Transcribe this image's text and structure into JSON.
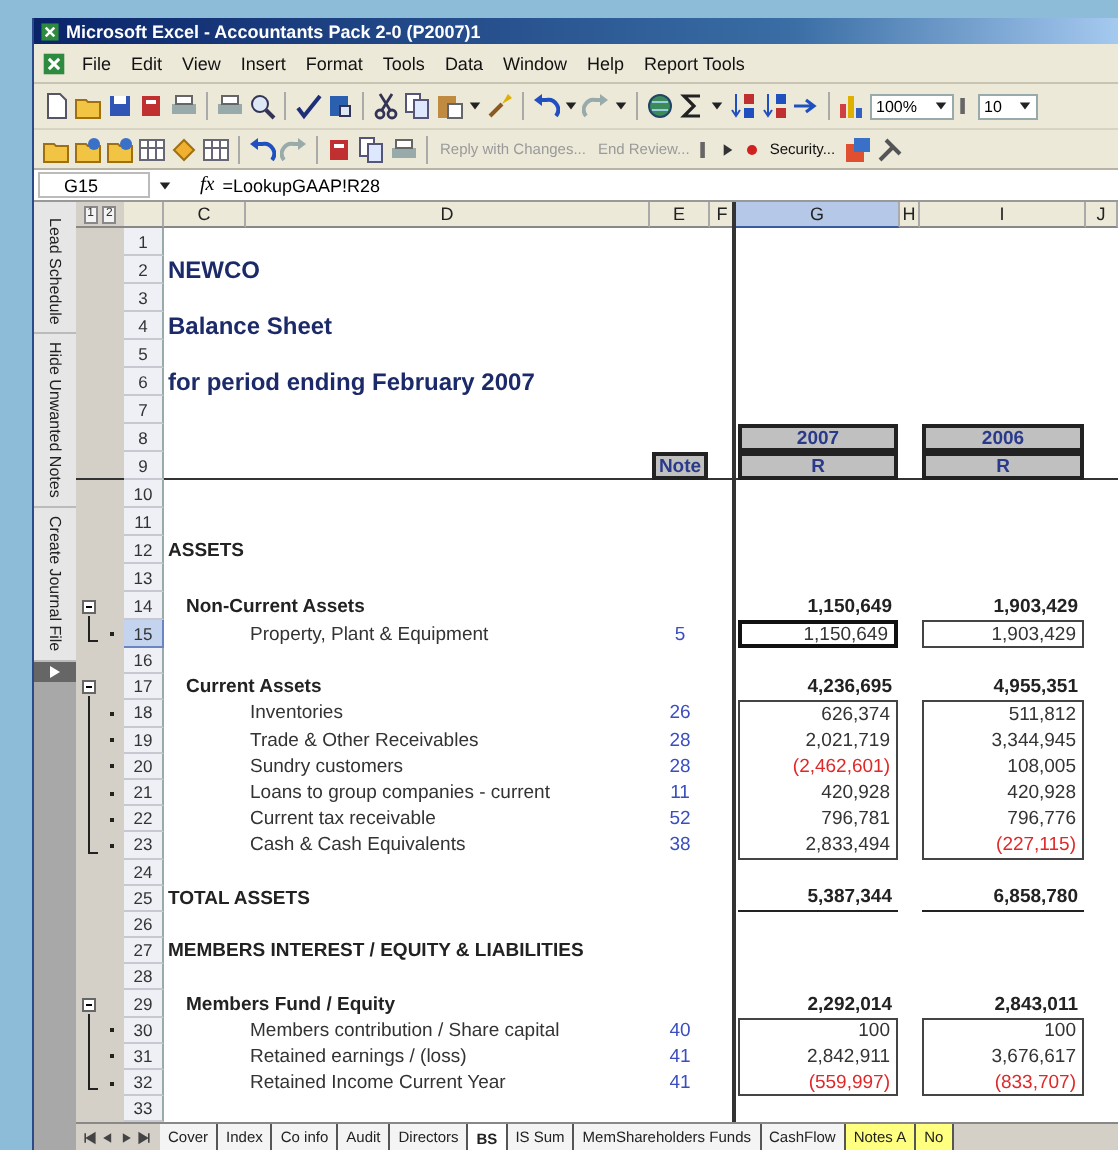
{
  "window": {
    "title": "Microsoft Excel - Accountants Pack 2-0 (P2007)1"
  },
  "menu": [
    "File",
    "Edit",
    "View",
    "Insert",
    "Format",
    "Tools",
    "Data",
    "Window",
    "Help",
    "Report Tools"
  ],
  "toolbar_1": {
    "zoom": "100%",
    "font_size": "10"
  },
  "toolbar_2": {
    "buttons": [
      {
        "label": "Reply with Changes...",
        "disabled": true
      },
      {
        "label": "End Review...",
        "disabled": true
      },
      {
        "label": "Security...",
        "disabled": false
      }
    ]
  },
  "formula_bar": {
    "name_box": "G15",
    "function_label": "fx",
    "formula": "=LookupGAAP!R28"
  },
  "side_pane": {
    "buttons": [
      "Lead Schedule",
      "Hide Unwanted Notes",
      "Create Journal File"
    ]
  },
  "sheet": {
    "outline_levels": [
      "1",
      "2"
    ],
    "columns": [
      {
        "label": "C",
        "selected": false
      },
      {
        "label": "D",
        "selected": false
      },
      {
        "label": "E",
        "selected": false
      },
      {
        "label": "F",
        "selected": false
      },
      {
        "label": "G",
        "selected": true
      },
      {
        "label": "H",
        "selected": false
      },
      {
        "label": "I",
        "selected": false
      },
      {
        "label": "J",
        "selected": false
      }
    ],
    "rows": [
      {
        "number": "1",
        "selected": false,
        "kind": "blank",
        "collapsible": false,
        "detail": false
      },
      {
        "number": "2",
        "selected": false,
        "kind": "title",
        "collapsible": false,
        "detail": false,
        "label": "NEWCO"
      },
      {
        "number": "3",
        "selected": false,
        "kind": "blank",
        "collapsible": false,
        "detail": false
      },
      {
        "number": "4",
        "selected": false,
        "kind": "title",
        "collapsible": false,
        "detail": false,
        "label": "Balance Sheet"
      },
      {
        "number": "5",
        "selected": false,
        "kind": "blank",
        "collapsible": false,
        "detail": false
      },
      {
        "number": "6",
        "selected": false,
        "kind": "title",
        "collapsible": false,
        "detail": false,
        "label": "for period ending February 2007"
      },
      {
        "number": "7",
        "selected": false,
        "kind": "blank",
        "collapsible": false,
        "detail": false
      },
      {
        "number": "8",
        "selected": false,
        "kind": "year_header",
        "collapsible": false,
        "detail": false,
        "values": [
          "2007",
          "2006"
        ]
      },
      {
        "number": "9",
        "selected": false,
        "kind": "unit_header",
        "collapsible": false,
        "detail": false,
        "note": "Note",
        "values": [
          "R",
          "R"
        ]
      },
      {
        "number": "10",
        "selected": false,
        "kind": "blank",
        "collapsible": false,
        "detail": false
      },
      {
        "number": "11",
        "selected": false,
        "kind": "blank",
        "collapsible": false,
        "detail": false
      },
      {
        "number": "12",
        "selected": false,
        "kind": "section",
        "collapsible": false,
        "detail": false,
        "label": "ASSETS"
      },
      {
        "number": "13",
        "selected": false,
        "kind": "blank",
        "collapsible": false,
        "detail": false
      },
      {
        "number": "14",
        "selected": false,
        "kind": "group",
        "collapsible": true,
        "detail": false,
        "label": "Non-Current Assets",
        "values": [
          {
            "text": "1,150,649",
            "negative": false
          },
          {
            "text": "1,903,429",
            "negative": false
          }
        ]
      },
      {
        "number": "15",
        "selected": true,
        "kind": "item",
        "collapsible": false,
        "detail": true,
        "label": "Property, Plant & Equipment",
        "note": "5",
        "values": [
          {
            "text": "1,150,649",
            "negative": false
          },
          {
            "text": "1,903,429",
            "negative": false
          }
        ]
      },
      {
        "number": "16",
        "selected": false,
        "kind": "blank",
        "collapsible": false,
        "detail": false
      },
      {
        "number": "17",
        "selected": false,
        "kind": "group",
        "collapsible": true,
        "detail": false,
        "label": "Current Assets",
        "values": [
          {
            "text": "4,236,695",
            "negative": false
          },
          {
            "text": "4,955,351",
            "negative": false
          }
        ]
      },
      {
        "number": "18",
        "selected": false,
        "kind": "item",
        "collapsible": false,
        "detail": true,
        "label": "Inventories",
        "note": "26",
        "values": [
          {
            "text": "626,374",
            "negative": false
          },
          {
            "text": "511,812",
            "negative": false
          }
        ]
      },
      {
        "number": "19",
        "selected": false,
        "kind": "item",
        "collapsible": false,
        "detail": true,
        "label": "Trade & Other Receivables",
        "note": "28",
        "values": [
          {
            "text": "2,021,719",
            "negative": false
          },
          {
            "text": "3,344,945",
            "negative": false
          }
        ]
      },
      {
        "number": "20",
        "selected": false,
        "kind": "item",
        "collapsible": false,
        "detail": true,
        "label": "Sundry customers",
        "note": "28",
        "values": [
          {
            "text": "(2,462,601)",
            "negative": true
          },
          {
            "text": "108,005",
            "negative": false
          }
        ]
      },
      {
        "number": "21",
        "selected": false,
        "kind": "item",
        "collapsible": false,
        "detail": true,
        "label": "Loans to group companies - current",
        "note": "11",
        "values": [
          {
            "text": "420,928",
            "negative": false
          },
          {
            "text": "420,928",
            "negative": false
          }
        ]
      },
      {
        "number": "22",
        "selected": false,
        "kind": "item",
        "collapsible": false,
        "detail": true,
        "label": "Current tax receivable",
        "note": "52",
        "values": [
          {
            "text": "796,781",
            "negative": false
          },
          {
            "text": "796,776",
            "negative": false
          }
        ]
      },
      {
        "number": "23",
        "selected": false,
        "kind": "item",
        "collapsible": false,
        "detail": true,
        "label": "Cash & Cash Equivalents",
        "note": "38",
        "values": [
          {
            "text": "2,833,494",
            "negative": false
          },
          {
            "text": "(227,115)",
            "negative": true
          }
        ]
      },
      {
        "number": "24",
        "selected": false,
        "kind": "blank",
        "collapsible": false,
        "detail": false
      },
      {
        "number": "25",
        "selected": false,
        "kind": "total",
        "collapsible": false,
        "detail": false,
        "label": "TOTAL ASSETS",
        "values": [
          {
            "text": "5,387,344",
            "negative": false
          },
          {
            "text": "6,858,780",
            "negative": false
          }
        ]
      },
      {
        "number": "26",
        "selected": false,
        "kind": "blank",
        "collapsible": false,
        "detail": false
      },
      {
        "number": "27",
        "selected": false,
        "kind": "section",
        "collapsible": false,
        "detail": false,
        "label": "MEMBERS INTEREST / EQUITY & LIABILITIES"
      },
      {
        "number": "28",
        "selected": false,
        "kind": "blank",
        "collapsible": false,
        "detail": false
      },
      {
        "number": "29",
        "selected": false,
        "kind": "group",
        "collapsible": true,
        "detail": false,
        "label": "Members Fund / Equity",
        "values": [
          {
            "text": "2,292,014",
            "negative": false
          },
          {
            "text": "2,843,011",
            "negative": false
          }
        ]
      },
      {
        "number": "30",
        "selected": false,
        "kind": "item",
        "collapsible": false,
        "detail": true,
        "label": "Members contribution / Share capital",
        "note": "40",
        "values": [
          {
            "text": "100",
            "negative": false
          },
          {
            "text": "100",
            "negative": false
          }
        ]
      },
      {
        "number": "31",
        "selected": false,
        "kind": "item",
        "collapsible": false,
        "detail": true,
        "label": "Retained earnings / (loss)",
        "note": "41",
        "values": [
          {
            "text": "2,842,911",
            "negative": false
          },
          {
            "text": "3,676,617",
            "negative": false
          }
        ]
      },
      {
        "number": "32",
        "selected": false,
        "kind": "item",
        "collapsible": false,
        "detail": true,
        "label": "Retained Income Current Year",
        "note": "41",
        "values": [
          {
            "text": "(559,997)",
            "negative": true
          },
          {
            "text": "(833,707)",
            "negative": true
          }
        ]
      },
      {
        "number": "33",
        "selected": false,
        "kind": "blank",
        "collapsible": false,
        "detail": false
      }
    ]
  },
  "sheet_tabs": [
    {
      "label": "Cover",
      "selected": false
    },
    {
      "label": "Index",
      "selected": false
    },
    {
      "label": "Co info",
      "selected": false
    },
    {
      "label": "Audit",
      "selected": false
    },
    {
      "label": "Directors",
      "selected": false
    },
    {
      "label": "BS",
      "selected": true
    },
    {
      "label": "IS Sum",
      "selected": false
    },
    {
      "label": "MemShareholders Funds",
      "selected": false
    },
    {
      "label": "CashFlow",
      "selected": false
    },
    {
      "label": "Notes A",
      "selected": false,
      "color": "#ffff80"
    },
    {
      "label": "No",
      "selected": false,
      "color": "#ffff80"
    }
  ]
}
